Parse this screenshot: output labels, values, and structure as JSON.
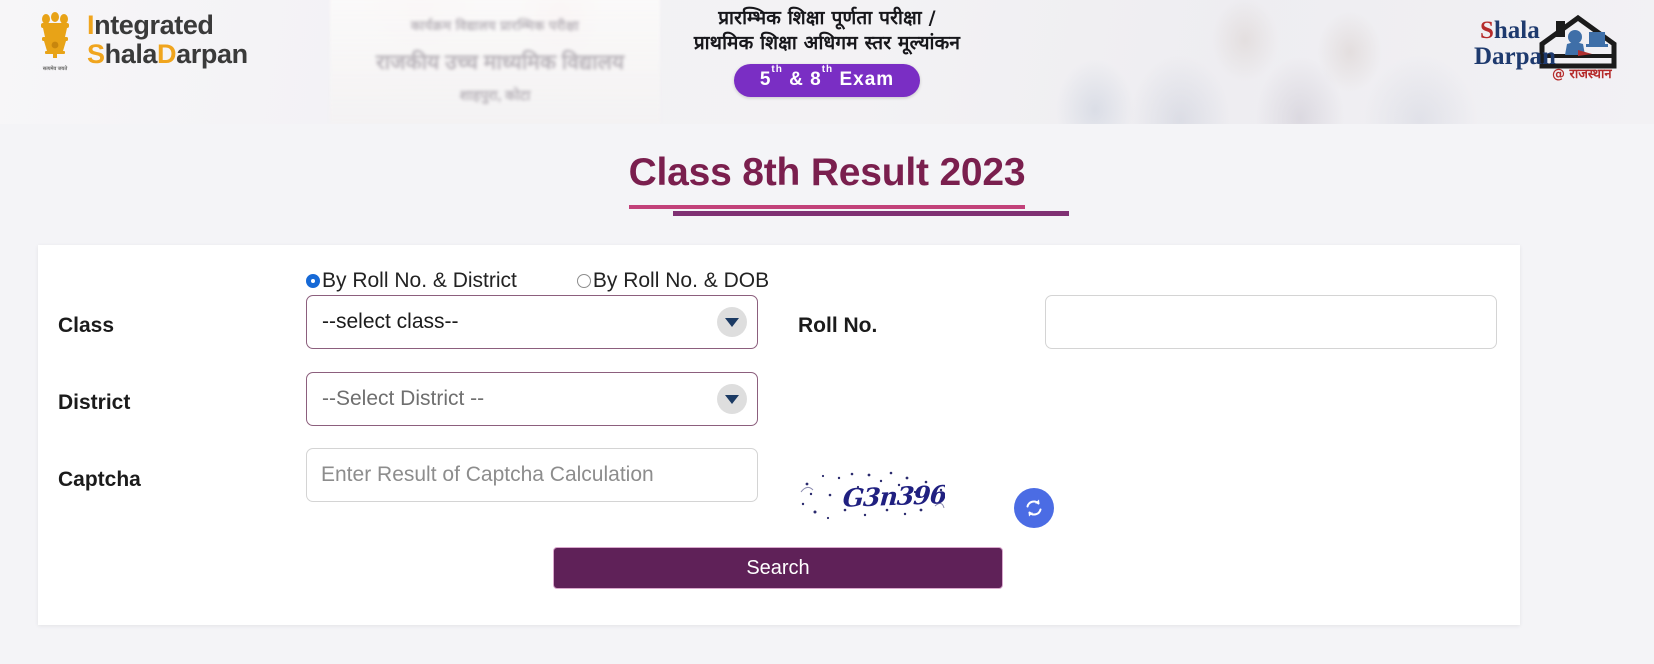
{
  "header": {
    "left_logo": {
      "line1_accent": "I",
      "line1_rest": "ntegrated",
      "line2_accent1": "S",
      "line2_mid": "hala",
      "line2_accent2": "D",
      "line2_rest": "arpan",
      "emblem_caption": "सत्यमेव जयते",
      "emblem_name": "national-emblem-of-india"
    },
    "center": {
      "hindi_line1": "प्रारम्भिक शिक्षा पूर्णता परीक्षा /",
      "hindi_line2": "प्राथमिक शिक्षा अधिगम स्तर मूल्यांकन",
      "badge_prefix": "5",
      "badge_sup1": "th",
      "badge_amp": " & 8",
      "badge_sup2": "th",
      "badge_suffix": " Exam",
      "badge_color": "#7a2ec4"
    },
    "background_board": {
      "blurred_line1": "कार्यक्रम विद्यालय प्रारम्भिक परीक्षा",
      "blurred_line2": "राजकीय उच्च माध्यमिक विद्यालय",
      "blurred_line3": "शाहपुरा, कोटा"
    },
    "right_logo": {
      "word1": "Shala",
      "word2": "Darpan",
      "tagline": "@ राजस्थान",
      "icon_name": "house-with-computer-icon"
    }
  },
  "page_title": {
    "text": "Class 8th Result 2023",
    "color": "#7a1f4e",
    "rule_1_color": "#c2417a",
    "rule_2_color": "#7f3073"
  },
  "form": {
    "modes": [
      {
        "label": "By Roll No. & District",
        "selected": true
      },
      {
        "label": "By Roll No. & DOB",
        "selected": false
      }
    ],
    "fields": {
      "class": {
        "label": "Class",
        "selected_value": "--select class--"
      },
      "district": {
        "label": "District",
        "selected_value": "--Select District --"
      },
      "roll_no": {
        "label": "Roll No.",
        "value": "",
        "placeholder": ""
      },
      "captcha": {
        "label": "Captcha",
        "value": "",
        "placeholder": "Enter Result of Captcha Calculation",
        "image_text": "G3n396",
        "refresh_icon": "refresh-icon",
        "refresh_color": "#4b6ce4"
      }
    },
    "search_button": {
      "label": "Search",
      "color": "#5f2158"
    }
  }
}
